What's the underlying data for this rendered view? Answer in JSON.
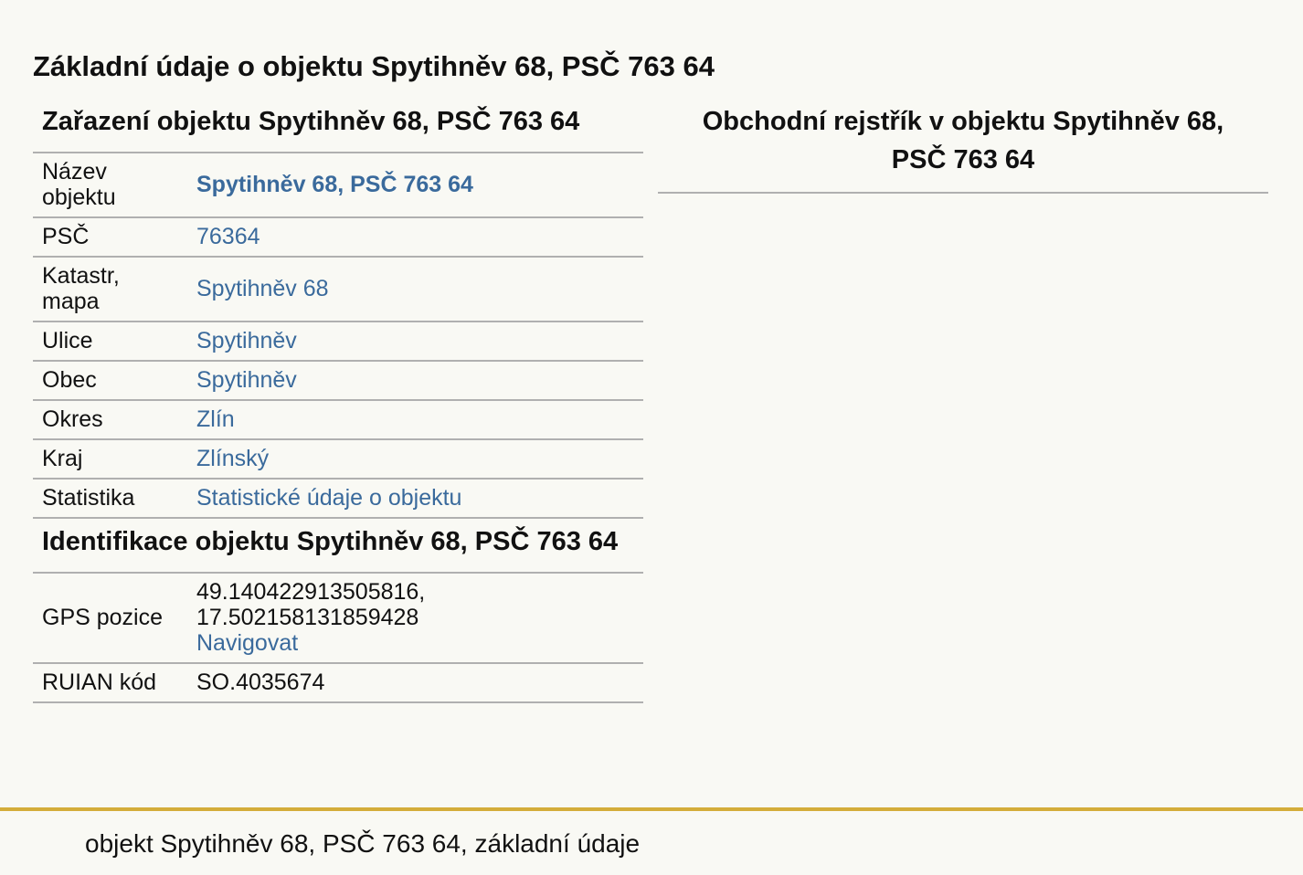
{
  "page_title": "Základní údaje o objektu Spytihněv 68, PSČ 763 64",
  "zarazeni": {
    "heading": "Zařazení objektu Spytihněv 68, PSČ 763 64",
    "rows": [
      {
        "label": "Název objektu",
        "value": "Spytihněv 68, PSČ 763 64"
      },
      {
        "label": "PSČ",
        "value": "76364"
      },
      {
        "label": "Katastr, mapa",
        "value": "Spytihněv 68"
      },
      {
        "label": "Ulice",
        "value": "Spytihněv"
      },
      {
        "label": "Obec",
        "value": "Spytihněv"
      },
      {
        "label": "Okres",
        "value": "Zlín"
      },
      {
        "label": "Kraj",
        "value": "Zlínský"
      },
      {
        "label": "Statistika",
        "value": "Statistické údaje o objektu"
      }
    ]
  },
  "identifikace": {
    "heading": "Identifikace objektu Spytihněv 68, PSČ 763 64",
    "gps": {
      "label": "GPS pozice",
      "lat": "49.140422913505816,",
      "lon": "17.502158131859428",
      "navigate": "Navigovat"
    },
    "ruian": {
      "label": "RUIAN kód",
      "value": "SO.4035674"
    }
  },
  "obchodni_rejstrik": {
    "heading": "Obchodní rejstřík v objektu Spytihněv 68, PSČ 763 64"
  },
  "footer": {
    "text": "objekt Spytihněv 68, PSČ 763 64, základní údaje"
  },
  "colors": {
    "background": "#f9f9f4",
    "link": "#3a6a9c",
    "divider": "#b0b0b0",
    "footer_rule": "#d4ad3a"
  }
}
